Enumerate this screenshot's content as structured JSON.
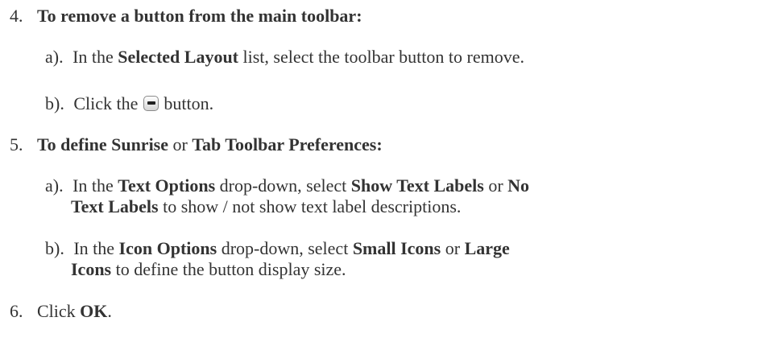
{
  "steps": [
    {
      "number": "4.",
      "heading": "To remove a button from the main toolbar:",
      "subs": [
        {
          "label": "a).",
          "t1": "In the ",
          "b1": "Selected Layout",
          "t2": " list, select the toolbar button to remove."
        },
        {
          "label": "b).",
          "t1": "Click the ",
          "icon": "minus-button-icon",
          "t2": " button."
        }
      ]
    },
    {
      "number": "5.",
      "heading_b1": "To define Sunrise",
      "heading_t1": " or ",
      "heading_b2": "Tab Toolbar Preferences:",
      "subs": [
        {
          "label": "a).",
          "t1": "In the ",
          "b1": "Text Options",
          "t2": " drop-down, select ",
          "b2": "Show Text Labels",
          "t3": " or ",
          "b3": "No",
          "l2_b1": "Text Labels",
          "l2_t1": " to show / not show text label descriptions."
        },
        {
          "label": "b).",
          "t1": "In the ",
          "b1": "Icon Options",
          "t2": " drop-down, select ",
          "b2": "Small Icons",
          "t3": " or ",
          "b3": "Large",
          "l2_b1": "Icons",
          "l2_t1": " to define the button display size."
        }
      ]
    },
    {
      "number": "6.",
      "t1": "Click ",
      "b1": "OK",
      "t2": "."
    }
  ]
}
